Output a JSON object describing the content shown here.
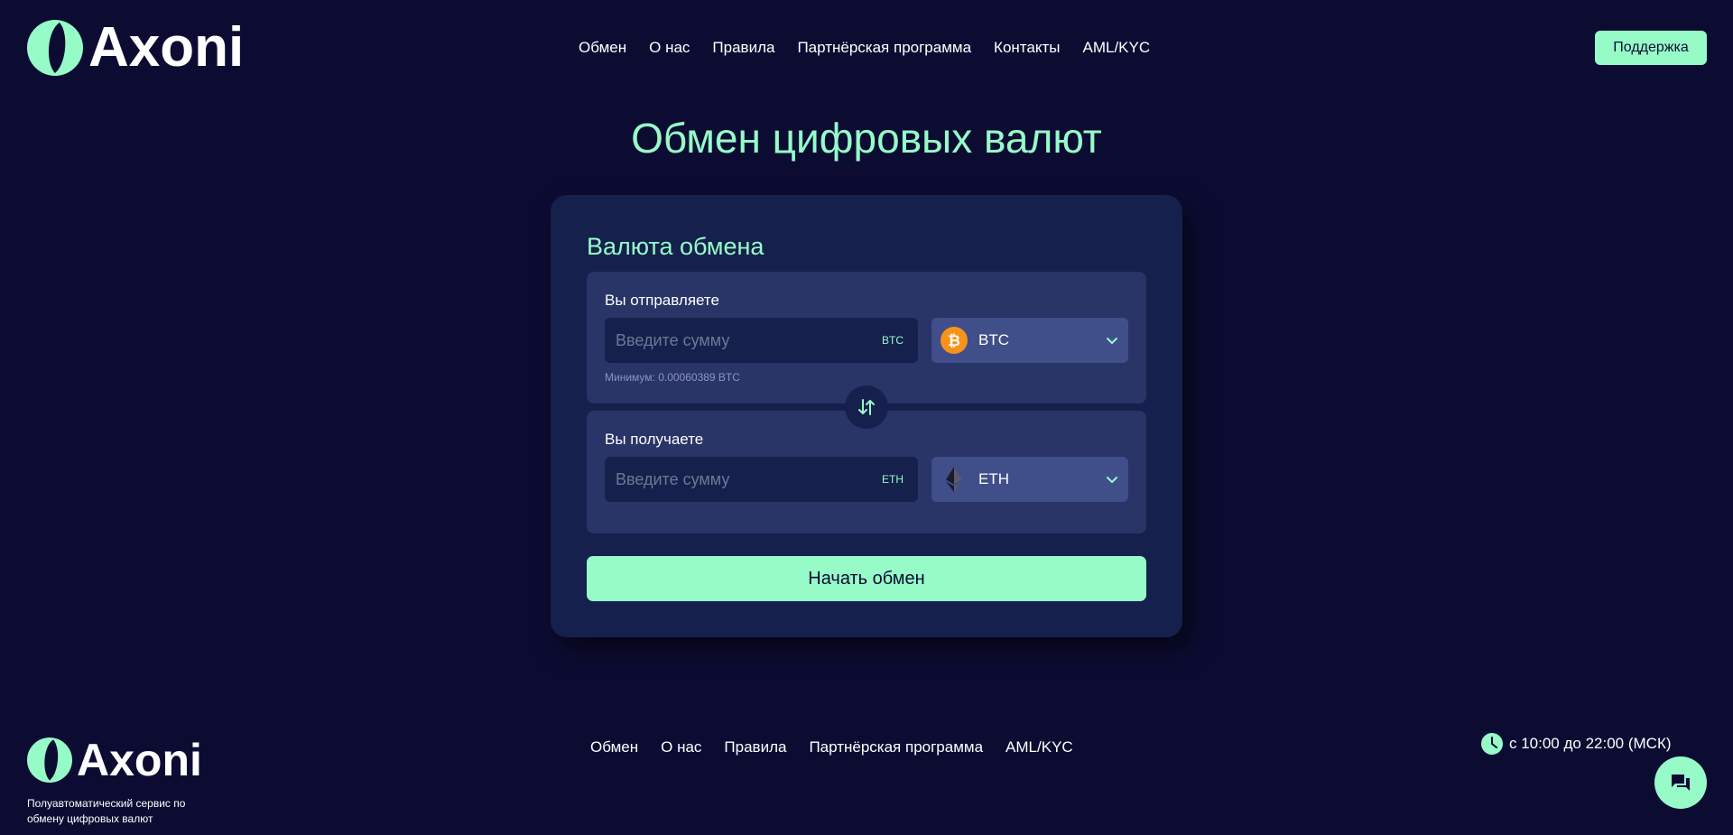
{
  "brand": {
    "name": "Axoni",
    "accent": "#96fbc7",
    "background": "#0c0c33"
  },
  "header": {
    "nav": [
      "Обмен",
      "О нас",
      "Правила",
      "Партнёрская программа",
      "Контакты",
      "AML/KYC"
    ],
    "support_label": "Поддержка"
  },
  "main": {
    "title": "Обмен цифровых валют",
    "card": {
      "title": "Валюта обмена",
      "send": {
        "label": "Вы отправляете",
        "placeholder": "Введите сумму",
        "unit": "BTC",
        "min_note": "Минимум: 0.00060389 BTC",
        "currency": "BTC",
        "icon": "bitcoin-icon"
      },
      "receive": {
        "label": "Вы получаете",
        "placeholder": "Введите сумму",
        "unit": "ETH",
        "currency": "ETH",
        "icon": "ethereum-icon"
      },
      "swap_icon": "swap-arrows-icon",
      "submit_label": "Начать обмен"
    }
  },
  "footer": {
    "tagline": "Полуавтоматический сервис по обмену цифровых валют",
    "nav": [
      "Обмен",
      "О нас",
      "Правила",
      "Партнёрская программа",
      "AML/KYC"
    ],
    "hours": "с 10:00 до 22:00 (МСК)",
    "chat_icon": "chat-icon"
  }
}
